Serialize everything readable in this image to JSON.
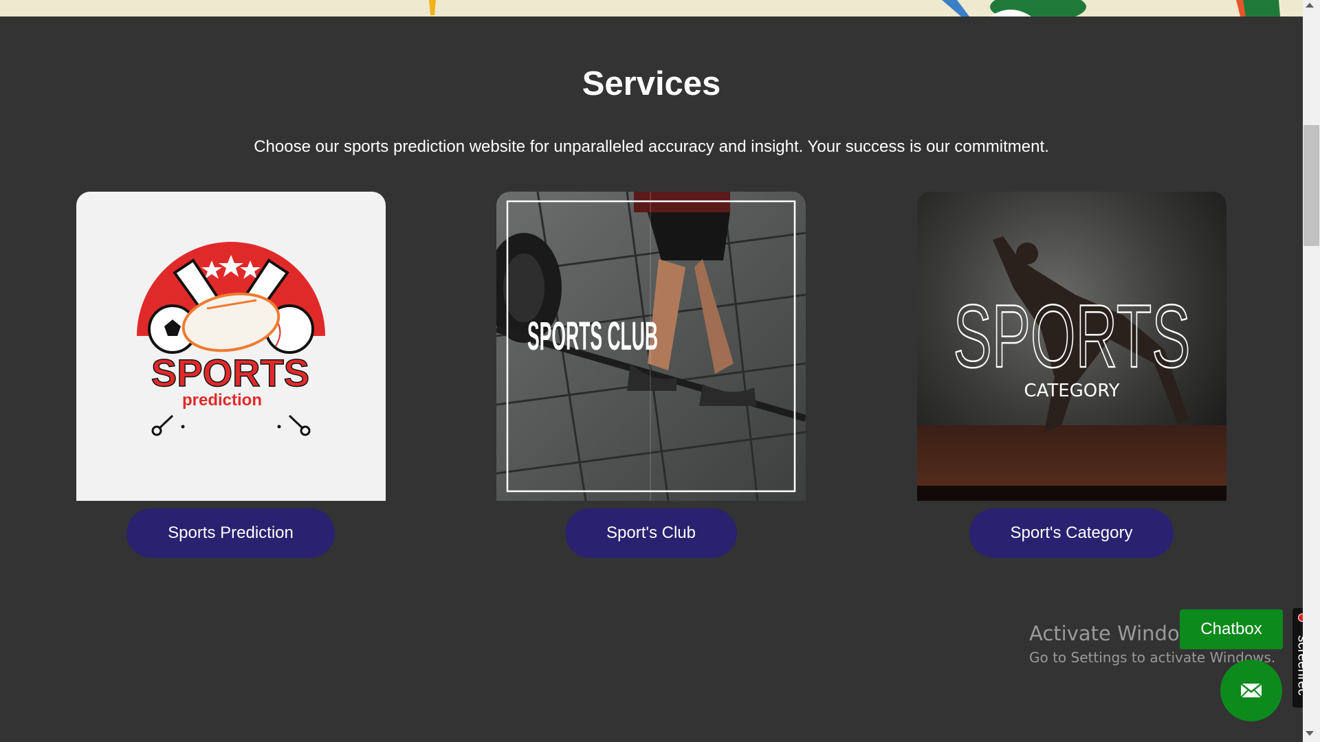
{
  "section": {
    "title": "Services",
    "subtitle": "Choose our sports prediction website for unparalleled accuracy and insight. Your success is our commitment."
  },
  "cards": [
    {
      "image_text_main": "SPORTS",
      "image_text_sub": "prediction",
      "button_label": "Sports Prediction"
    },
    {
      "image_text_main": "SPORTS CLUB",
      "button_label": "Sport's Club"
    },
    {
      "image_text_main": "SPORTS",
      "image_text_sub": "CATEGORY",
      "button_label": "Sport's Category"
    }
  ],
  "watermark": {
    "line1": "Activate Windows",
    "line2": "Go to Settings to activate Windows."
  },
  "chat": {
    "button_label": "Chatbox",
    "fab_icon": "mail-icon"
  },
  "screenrec": {
    "label": "screenrec"
  },
  "colors": {
    "background": "#333333",
    "button": "#2a2170",
    "chat_green": "#0c8a1c",
    "logo_red": "#e02a2a"
  }
}
